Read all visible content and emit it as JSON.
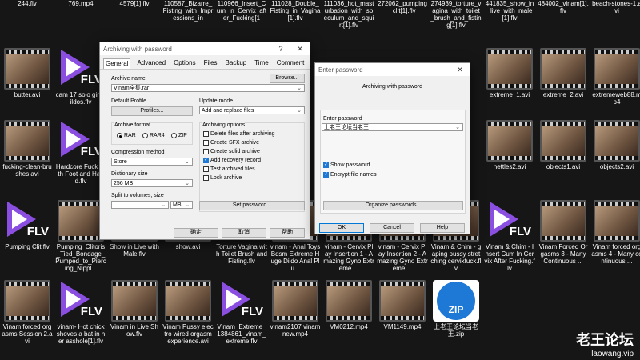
{
  "desktop": {
    "top_labels": [
      "244.flv",
      "769.mp4",
      "4579[1].flv",
      "110587_Bizarre_Fisting_with_Impressions_in",
      "110966_Insert_Cum_in_Cervix_after_Fucking[1",
      "111028_Double_Fisting_in_Vagina[1].flv",
      "111036_hot_masturbation_with_speculum_and_squirt[1].flv",
      "272062_pumping_clit[1].flv",
      "274939_torture_vagina_with_toilet_brush_and_fisting[1].flv",
      "441835_show_in_live_with_male[1].flv",
      "484002_vinam[1].flv",
      "beach-stones-1.avi"
    ],
    "row2": [
      "butter.avi",
      "cam 17 solo girl dildos.flv",
      "",
      "",
      "",
      "",
      "",
      "",
      "",
      "extreme_1.avi",
      "extreme_2.avi",
      "extremeweb88.mp4"
    ],
    "row3": [
      "fucking-clean-brushes.avi",
      "Hardcore Fuck with Foot and Hand.flv",
      "",
      "",
      "",
      "",
      "",
      "",
      "",
      "nettles2.avi",
      "objects1.avi",
      "objects2.avi"
    ],
    "row4": [
      "Pumping Clit.flv",
      "Pumping_Clitoris_Tied_Bondage_Pumped_to_Piercing_Nippl...",
      "Show in Live with Male.flv",
      "show.avi",
      "Torture Vagina with Toilet Brush and Fisting.flv",
      "vinam - Anal Toys Bdsm Extreme Huge Dildo Anal Plu...",
      "vinam - Cervix Play Insertion 1 - Amazing Gyno Extreme ...",
      "vinam - Cervix Play Insertion 2 - Amazing Gyno Extreme ...",
      "Vinam & Chim - gaping pussy stretching cervixfuck.flv",
      "Vinam & Chim - Insert Cum In Cervix After Fucking.flv",
      "Vinam Forced Orgasms 3 - Many Continuous ...",
      "Vinam forced orgasms 4 - Many continuous ..."
    ],
    "row5": [
      "Vinam forced orgasms Session 2.avi",
      "vinam- Hot chick shoves a bat in her asshole[1].flv",
      "Vinam in Live Show.flv",
      "Vinam Pussy electro wired orgasm experience.avi",
      "Vinam_Extreme_1384861_vinam_extreme.flv",
      "vinam2107 vinam new.mp4",
      "VM0212.mp4",
      "VM1149.mp4",
      "上老王论坛当老王.zip"
    ],
    "flv_text": "FLV",
    "zip_text": "ZIP",
    "watermark_cn": "老王论坛",
    "watermark_url": "laowang.vip"
  },
  "archive_dialog": {
    "title": "Archiving with password",
    "help_glyph": "?",
    "close_glyph": "✕",
    "tabs": [
      "General",
      "Advanced",
      "Options",
      "Files",
      "Backup",
      "Time",
      "Comment"
    ],
    "archive_name_label": "Archive name",
    "archive_name_value": "Vinam全集.rar",
    "browse_label": "Browse...",
    "default_profile_label": "Default Profile",
    "profiles_label": "Profiles...",
    "update_mode_label": "Update mode",
    "update_mode_value": "Add and replace files",
    "archive_format_label": "Archive format",
    "formats": [
      "RAR",
      "RAR4",
      "ZIP"
    ],
    "selected_format": "RAR",
    "compression_method_label": "Compression method",
    "compression_method_value": "Store",
    "dictionary_size_label": "Dictionary size",
    "dictionary_size_value": "256 MB",
    "split_label": "Split to volumes, size",
    "split_value": "",
    "split_unit": "MB",
    "archiving_options_label": "Archiving options",
    "options": [
      {
        "label": "Delete files after archiving",
        "checked": false
      },
      {
        "label": "Create SFX archive",
        "checked": false
      },
      {
        "label": "Create solid archive",
        "checked": false
      },
      {
        "label": "Add recovery record",
        "checked": true
      },
      {
        "label": "Test archived files",
        "checked": false
      },
      {
        "label": "Lock archive",
        "checked": false
      }
    ],
    "set_password_label": "Set password...",
    "ok_label": "确定",
    "cancel_label": "取消",
    "help_label": "帮助"
  },
  "password_dialog": {
    "title": "Enter password",
    "close_glyph": "✕",
    "heading": "Archiving with password",
    "enter_password_label": "Enter password",
    "password_value": "上老王论坛当老王",
    "show_password_label": "Show password",
    "show_password_checked": true,
    "encrypt_names_label": "Encrypt file names",
    "encrypt_names_checked": true,
    "organize_label": "Organize passwords...",
    "ok_label": "OK",
    "cancel_label": "Cancel",
    "help_label": "Help"
  },
  "colors": {
    "flv_purple": "#8a4fe0",
    "zip_blue": "#1e78d6",
    "accent": "#0078d7"
  }
}
